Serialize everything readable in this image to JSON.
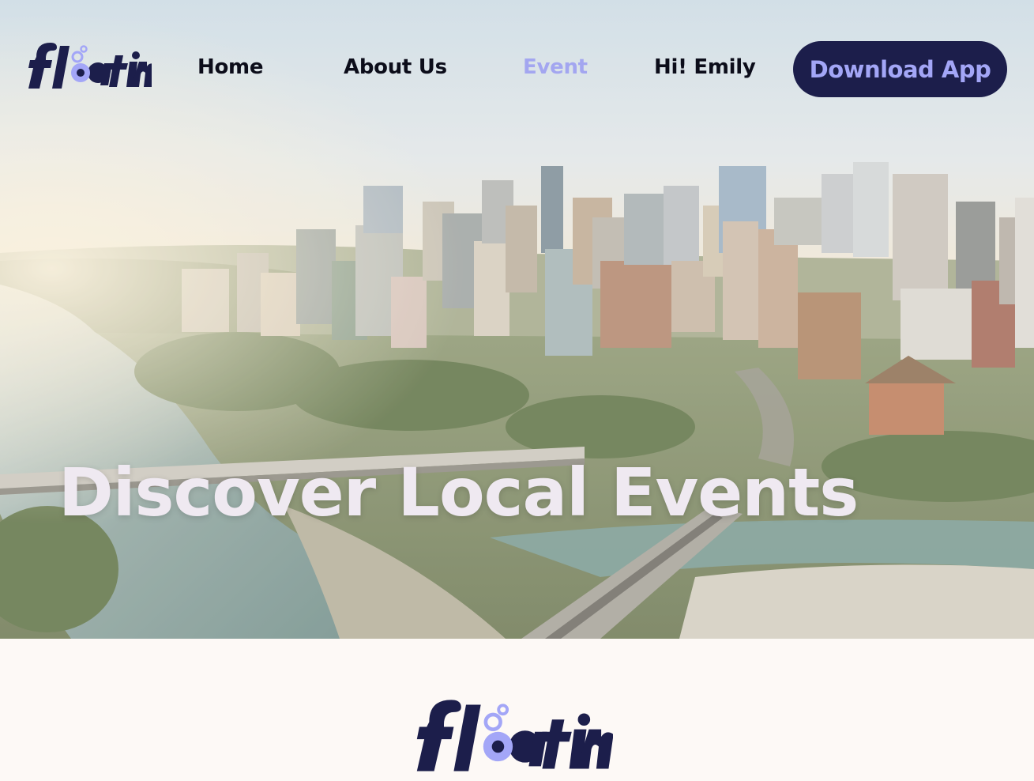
{
  "brand": {
    "name": "floatin"
  },
  "nav": {
    "items": [
      {
        "label": "Home"
      },
      {
        "label": "About Us"
      },
      {
        "label": "Event"
      },
      {
        "label": "Hi! Emily"
      }
    ],
    "active": "Event",
    "download_label": "Download App"
  },
  "hero": {
    "title": "Discover Local Events",
    "image_icon": "city-skyline-photo"
  },
  "colors": {
    "brand_navy": "#1c1e4b",
    "brand_lavender": "#a3a6f7",
    "nav_text": "#0c0d1a",
    "hero_title": "#efe9f1",
    "page_bg": "#fdf9f6"
  }
}
